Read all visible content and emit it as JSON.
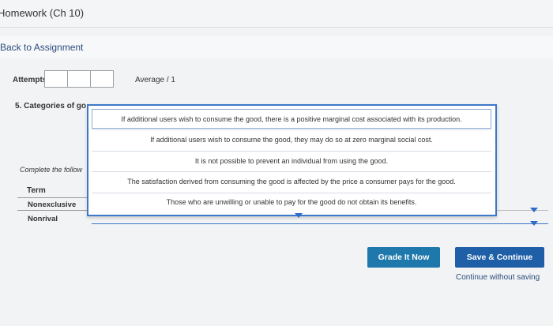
{
  "header": {
    "title": "Homework (Ch 10)"
  },
  "nav": {
    "back_label": "Back to Assignment"
  },
  "attempts": {
    "label": "Attempts",
    "average": "Average / 1"
  },
  "question": {
    "title": "5. Categories of go",
    "instructions": "Complete the follow",
    "term_header": "Term",
    "rows": [
      {
        "term": "Nonexclusive"
      },
      {
        "term": "Nonrival"
      }
    ]
  },
  "dropdown": {
    "options": [
      "If additional users wish to consume the good, there is a positive marginal cost associated with its production.",
      "If additional users wish to consume the good, they may do so at zero marginal social cost.",
      "It is not possible to prevent an individual from using the good.",
      "The satisfaction derived from consuming the good is affected by the price a consumer pays for the good.",
      "Those who are unwilling or unable to pay for the good do not obtain its benefits."
    ],
    "highlighted_index": 0
  },
  "actions": {
    "grade_label": "Grade It Now",
    "save_label": "Save & Continue",
    "continue_label": "Continue without saving"
  },
  "colors": {
    "accent": "#2f6cc7",
    "grade_button": "#1e78ab",
    "save_button": "#1f5fa8",
    "link": "#2b4c7e"
  }
}
